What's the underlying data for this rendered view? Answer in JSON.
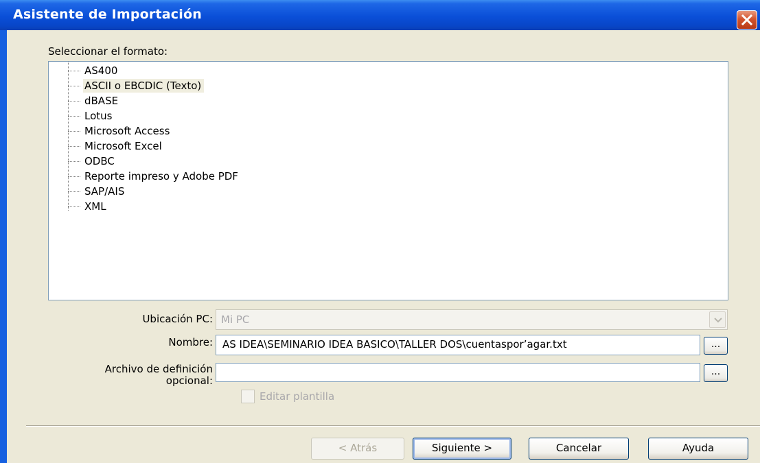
{
  "window": {
    "title": "Asistente de Importación"
  },
  "format_label": "Seleccionar el formato:",
  "formats": [
    "AS400",
    "ASCII o EBCDIC (Texto)",
    "dBASE",
    "Lotus",
    "Microsoft Access",
    "Microsoft Excel",
    "ODBC",
    "Reporte impreso y Adobe PDF",
    "SAP/AIS",
    "XML"
  ],
  "selected_format": "ASCII o EBCDIC (Texto)",
  "location": {
    "label": "Ubicación PC:",
    "value": "Mi PC"
  },
  "name": {
    "label": "Nombre:",
    "value": "AS IDEA\\SEMINARIO IDEA BASICO\\TALLER DOS\\cuentasporʼagar.txt",
    "browse_label": "..."
  },
  "definition": {
    "label_line1": "Archivo de definición",
    "label_line2": "opcional:",
    "value": "",
    "browse_label": "..."
  },
  "edit_template": {
    "label": "Editar plantilla",
    "checked": false
  },
  "buttons": {
    "back": "< Atrás",
    "next": "Siguiente >",
    "cancel": "Cancelar",
    "help": "Ayuda"
  }
}
